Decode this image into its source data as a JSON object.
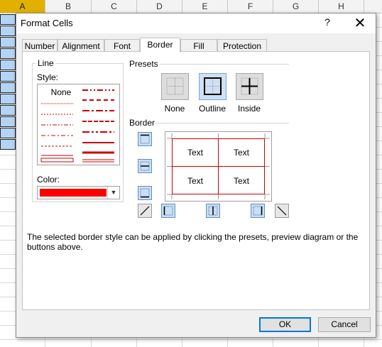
{
  "spreadsheet": {
    "columns": [
      "A",
      "B",
      "C",
      "D",
      "E",
      "F",
      "G",
      "H"
    ]
  },
  "dialog": {
    "title": "Format Cells",
    "help": "?",
    "close": "✕"
  },
  "tabs": [
    "Number",
    "Alignment",
    "Font",
    "Border",
    "Fill",
    "Protection"
  ],
  "active_tab": "Border",
  "line": {
    "group_label": "Line",
    "style_label": "Style:",
    "none_label": "None",
    "color_label": "Color:",
    "color_value": "#ff0000"
  },
  "presets": {
    "label": "Presets",
    "items": [
      "None",
      "Outline",
      "Inside"
    ]
  },
  "border": {
    "label": "Border",
    "preview_cells": [
      "Text",
      "Text",
      "Text",
      "Text"
    ]
  },
  "hint": "The selected border style can be applied by clicking the presets, preview diagram or the buttons above.",
  "buttons": {
    "ok": "OK",
    "cancel": "Cancel"
  },
  "colors": {
    "accent": "#0078d7",
    "line": "#cc0000"
  }
}
